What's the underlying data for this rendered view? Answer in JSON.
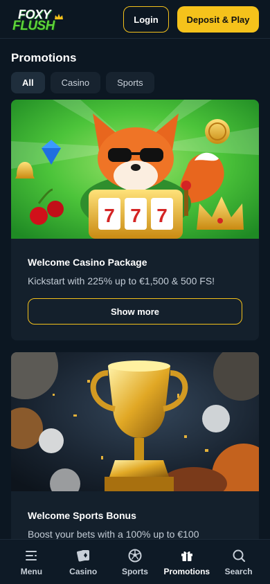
{
  "header": {
    "logo_line1": "FOXY",
    "logo_line2": "FLUSH",
    "login_label": "Login",
    "deposit_label": "Deposit & Play"
  },
  "page": {
    "title": "Promotions",
    "filters": [
      {
        "label": "All",
        "active": true
      },
      {
        "label": "Casino",
        "active": false
      },
      {
        "label": "Sports",
        "active": false
      }
    ]
  },
  "promotions": [
    {
      "title": "Welcome Casino Package",
      "description": "Kickstart with 225% up to €1,500 & 500 FS!",
      "button_label": "Show more",
      "image": "fox-slot-machine-illustration",
      "slot_digits": "777"
    },
    {
      "title": "Welcome Sports Bonus",
      "description": "Boost your bets with a 100% up to €100",
      "image": "golden-trophy-with-balls"
    }
  ],
  "bottom_nav": [
    {
      "label": "Menu",
      "icon": "menu-icon",
      "active": false
    },
    {
      "label": "Casino",
      "icon": "casino-icon",
      "active": false
    },
    {
      "label": "Sports",
      "icon": "soccer-ball-icon",
      "active": false
    },
    {
      "label": "Promotions",
      "icon": "gift-icon",
      "active": true
    },
    {
      "label": "Search",
      "icon": "search-icon",
      "active": false
    }
  ],
  "colors": {
    "background": "#0c1722",
    "card": "#14202c",
    "accent": "#f5c21b",
    "logo_green": "#5fd33a"
  }
}
